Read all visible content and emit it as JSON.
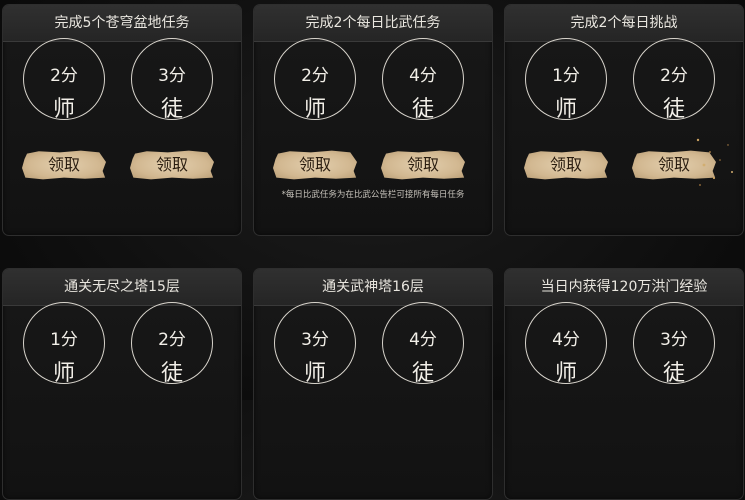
{
  "tasks": [
    {
      "title": "完成5个苍穹盆地任务",
      "master_score": "2分",
      "master_label": "师",
      "apprentice_score": "3分",
      "apprentice_label": "徒",
      "claim_label_1": "领取",
      "claim_label_2": "领取"
    },
    {
      "title": "完成2个每日比武任务",
      "master_score": "2分",
      "master_label": "师",
      "apprentice_score": "4分",
      "apprentice_label": "徒",
      "claim_label_1": "领取",
      "claim_label_2": "领取",
      "note": "*每日比武任务为在比武公告栏可接所有每日任务"
    },
    {
      "title": "完成2个每日挑战",
      "master_score": "1分",
      "master_label": "师",
      "apprentice_score": "2分",
      "apprentice_label": "徒",
      "claim_label_1": "领取",
      "claim_label_2": "领取"
    },
    {
      "title": "通关无尽之塔15层",
      "master_score": "1分",
      "master_label": "师",
      "apprentice_score": "2分",
      "apprentice_label": "徒"
    },
    {
      "title": "通关武神塔16层",
      "master_score": "3分",
      "master_label": "师",
      "apprentice_score": "4分",
      "apprentice_label": "徒"
    },
    {
      "title": "当日内获得120万洪门经验",
      "master_score": "4分",
      "master_label": "师",
      "apprentice_score": "3分",
      "apprentice_label": "徒"
    }
  ]
}
